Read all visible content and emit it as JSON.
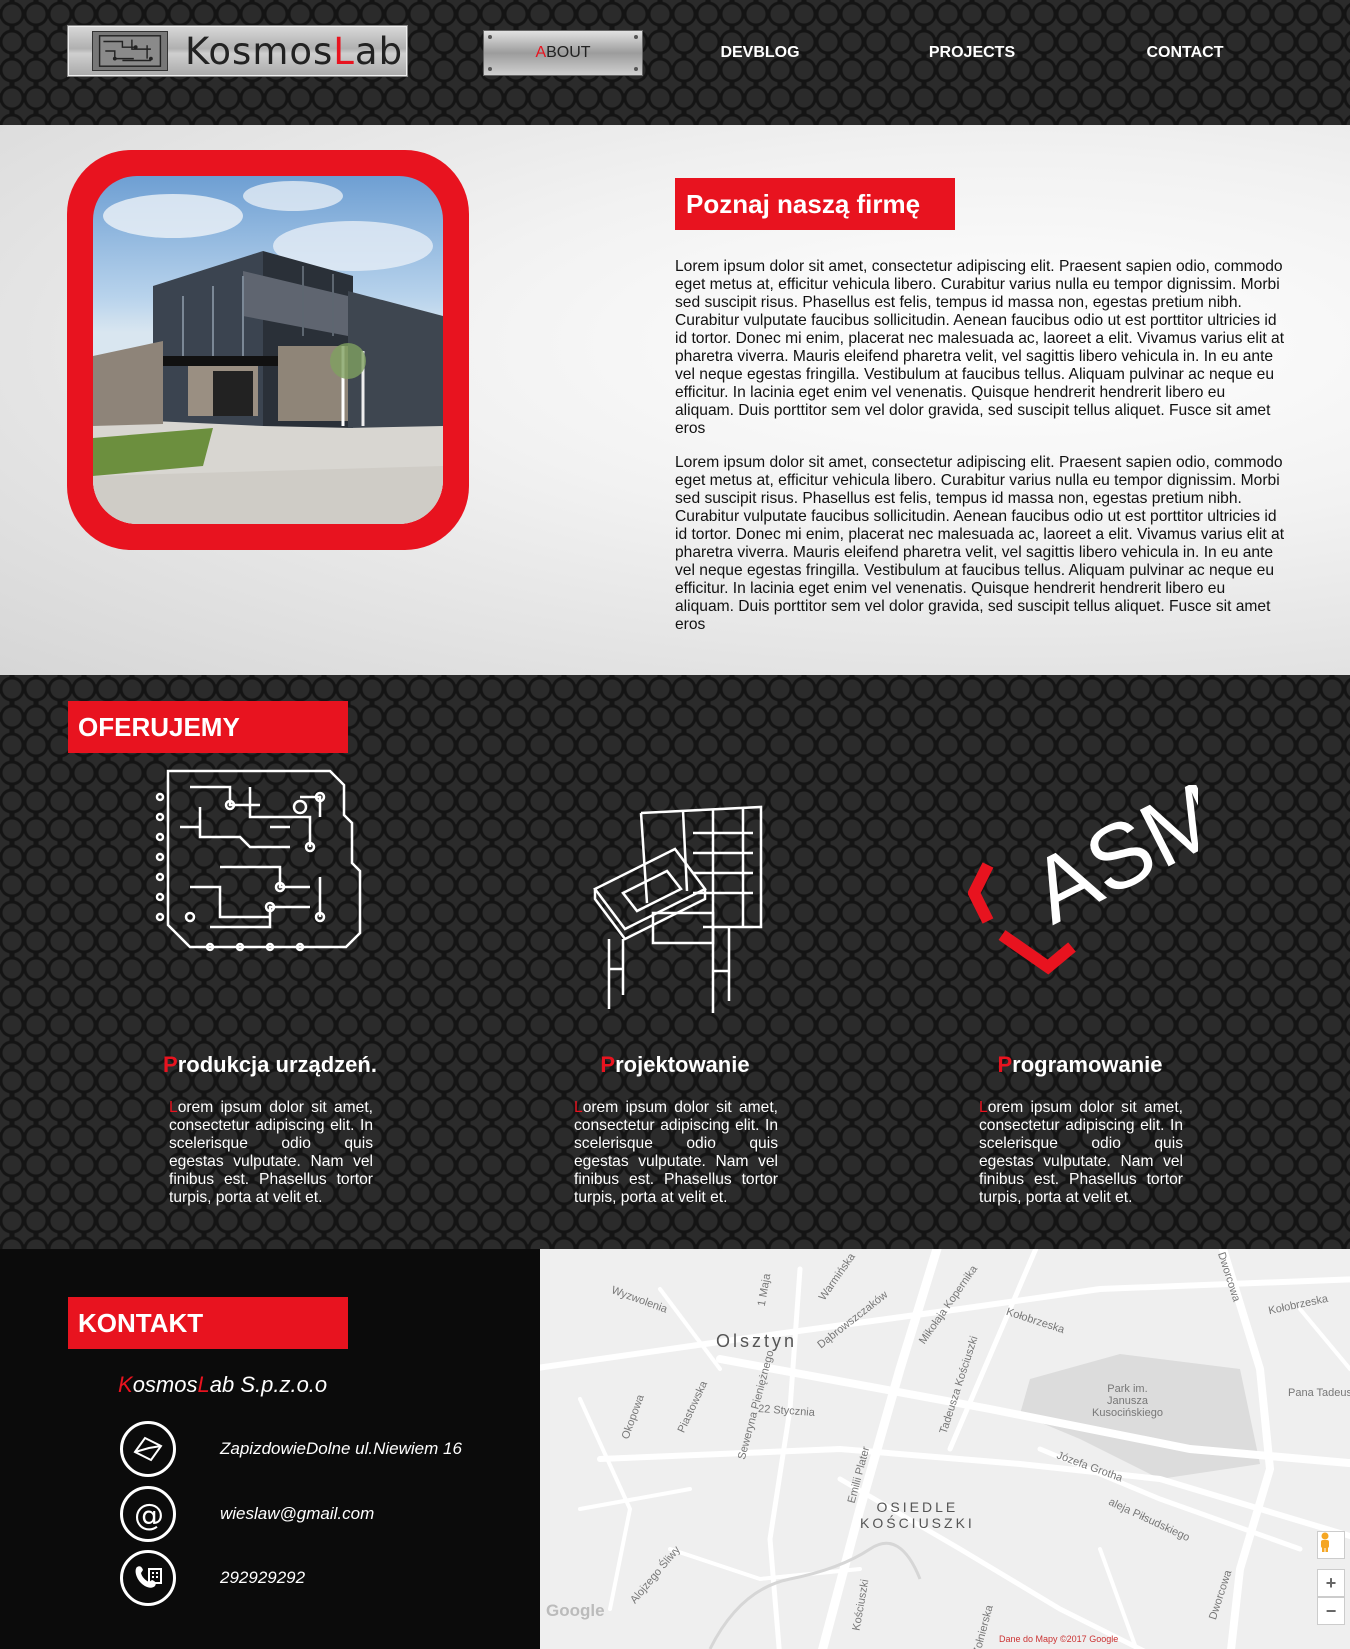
{
  "header": {
    "logo": {
      "prefix": "Kosmos",
      "red": "L",
      "suffix": "ab"
    },
    "nav": [
      {
        "first": "A",
        "rest": "BOUT",
        "active": true
      },
      {
        "label": "DEVBLOG"
      },
      {
        "label": "PROJECTS"
      },
      {
        "label": "CONTACT"
      }
    ]
  },
  "about": {
    "title": "Poznaj naszą firmę",
    "paragraphs": [
      "Lorem ipsum dolor sit amet, consectetur adipiscing elit. Praesent sapien odio, commodo eget metus at, efficitur vehicula libero. Curabitur varius nulla eu tempor dignissim. Morbi sed suscipit risus. Phasellus est felis, tempus id massa non, egestas pretium nibh. Curabitur vulputate faucibus sollicitudin. Aenean faucibus odio ut est porttitor ultricies id id tortor. Donec mi enim, placerat nec malesuada ac, laoreet a elit. Vivamus varius elit at pharetra viverra. Mauris eleifend pharetra velit, vel sagittis libero vehicula in. In eu ante vel neque egestas fringilla. Vestibulum at faucibus tellus. Aliquam pulvinar ac neque eu efficitur. In lacinia eget enim vel venenatis. Quisque hendrerit hendrerit libero eu aliquam. Duis porttitor sem vel dolor gravida, sed suscipit tellus aliquet. Fusce sit amet eros",
      "Lorem ipsum dolor sit amet, consectetur adipiscing elit. Praesent sapien odio, commodo eget metus at, efficitur vehicula libero. Curabitur varius nulla eu tempor dignissim. Morbi sed suscipit risus. Phasellus est felis, tempus id massa non, egestas pretium nibh. Curabitur vulputate faucibus sollicitudin. Aenean faucibus odio ut est porttitor ultricies id id tortor. Donec mi enim, placerat nec malesuada ac, laoreet a elit. Vivamus varius elit at pharetra viverra. Mauris eleifend pharetra velit, vel sagittis libero vehicula in. In eu ante vel neque egestas fringilla. Vestibulum at faucibus tellus. Aliquam pulvinar ac neque eu efficitur. In lacinia eget enim vel venenatis. Quisque hendrerit hendrerit libero eu aliquam. Duis porttitor sem vel dolor gravida, sed suscipit tellus aliquet. Fusce sit amet eros"
    ]
  },
  "offer": {
    "title": "OFERUJEMY",
    "asm_text": "ASM",
    "items": [
      {
        "icon": "circuit-board-icon",
        "first": "P",
        "rest": "rodukcja urządzeń.",
        "text_first": "L",
        "text_rest": "orem ipsum dolor sit amet, consectetur adipiscing elit. In scelerisque odio quis egestas vulputate. Nam vel finibus est. Phasellus tortor turpis, porta at velit et."
      },
      {
        "icon": "drafting-desk-icon",
        "first": "P",
        "rest": "rojektowanie",
        "text_first": "L",
        "text_rest": "orem ipsum dolor sit amet, consectetur adipiscing elit. In scelerisque odio quis egestas vulputate. Nam vel finibus est. Phasellus tortor turpis, porta at velit et."
      },
      {
        "icon": "asm-logo-icon",
        "first": "P",
        "rest": "rogramowanie",
        "text_first": "L",
        "text_rest": "orem ipsum dolor sit amet, consectetur adipiscing elit. In scelerisque odio quis egestas vulputate. Nam vel finibus est. Phasellus tortor turpis, porta at velit et."
      }
    ]
  },
  "contact": {
    "title": "KONTAKT",
    "company": {
      "k": "K",
      "osmos": "osmos",
      "l": "L",
      "rest": "ab S.p.z.o.o"
    },
    "address": "ZapizdowieDolne ul.Niewiem 16",
    "email": "wieslaw@gmail.com",
    "phone": "292929292"
  },
  "map": {
    "city": "Olsztyn",
    "district": "OSIEDLE\nKOŚCIUSZKI",
    "park": "Park im.\nJanusza\nKusocińskiego",
    "streets": [
      "Wyzwolenia",
      "1 Maja",
      "Warmińska",
      "Dąbrowszczaków",
      "Mikołaja Kopernika",
      "Kołobrzeska",
      "Kołobrzeska",
      "Dworcowa",
      "Pana Tadeusza",
      "Tadeusza Kościuszki",
      "Seweryna Pieniężnego",
      "22 Stycznia",
      "Okopowa",
      "Piastowska",
      "Józefa Grotha",
      "aleja Piłsudskiego",
      "Emilii Plater",
      "Alojzego Śliwy",
      "Kościuszki",
      "Dworcowa",
      "Żołnierska"
    ],
    "google": "Google",
    "attribution": "Dane do Mapy ©2017 Google",
    "zoom_in": "+",
    "zoom_out": "−"
  },
  "colors": {
    "accent": "#e8131f",
    "dark": "#1a1a1a"
  }
}
